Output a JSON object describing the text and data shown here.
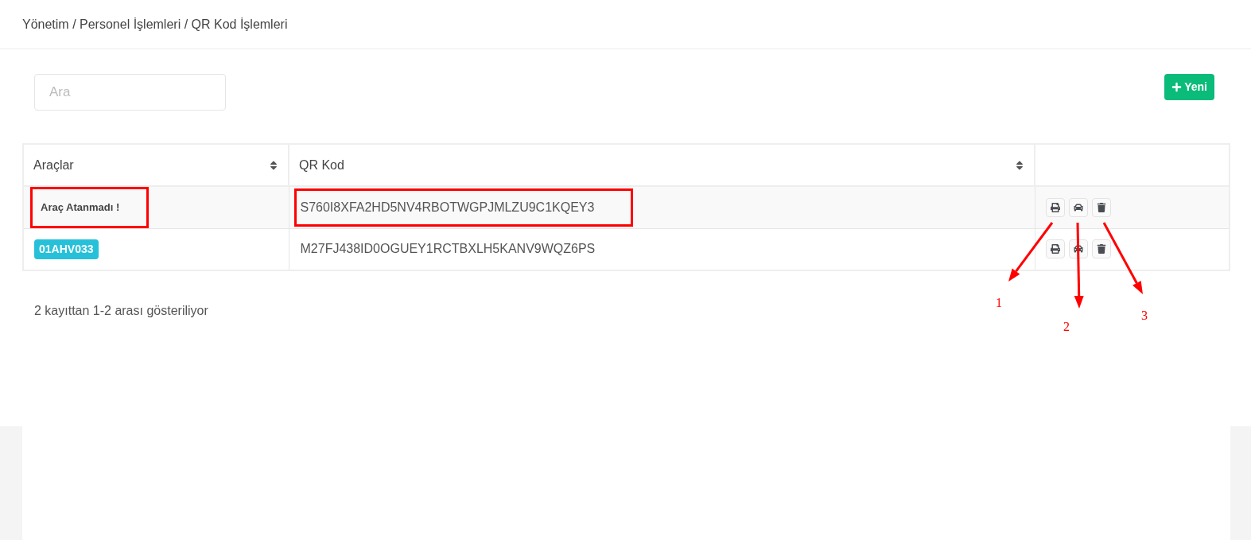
{
  "breadcrumb": "Yönetim / Personel İşlemleri / QR Kod İşlemleri",
  "search": {
    "placeholder": "Ara"
  },
  "new_button": {
    "label": "Yeni"
  },
  "table": {
    "columns": [
      {
        "label": "Araçlar",
        "sortable": true
      },
      {
        "label": "QR Kod",
        "sortable": true
      }
    ],
    "rows": [
      {
        "vehicle": {
          "kind": "plain",
          "text": "Araç Atanmadı !",
          "highlighted": true
        },
        "qr_code": {
          "text": "S760I8XFA2HD5NV4RBOTWGPJMLZU9C1KQEY3",
          "highlighted": true
        },
        "actions": [
          {
            "kind": "print"
          },
          {
            "kind": "car"
          },
          {
            "kind": "delete"
          }
        ]
      },
      {
        "vehicle": {
          "kind": "badge",
          "text": "01AHV033",
          "highlighted": false
        },
        "qr_code": {
          "text": "M27FJ438ID0OGUEY1RCTBXLH5KANV9WQZ6PS",
          "highlighted": false
        },
        "actions": [
          {
            "kind": "print"
          },
          {
            "kind": "car"
          },
          {
            "kind": "delete"
          }
        ]
      }
    ]
  },
  "footer": "2 kayıttan 1-2 arası gösteriliyor",
  "annotations": [
    {
      "label": "1"
    },
    {
      "label": "2"
    },
    {
      "label": "3"
    }
  ]
}
